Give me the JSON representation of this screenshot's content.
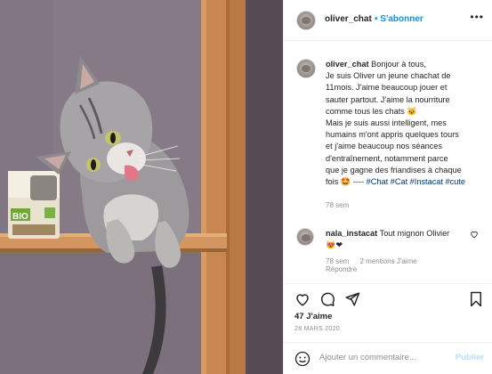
{
  "post": {
    "username": "oliver_chat",
    "follow_label": "S'abonner",
    "more_label": "•••",
    "caption_lines": [
      "Bonjour à tous,",
      "Je suis Oliver un jeune chachat de",
      "11mois. J'aime beaucoup jouer et",
      "sauter partout. J'aime la nourriture",
      "comme tous les chats 🐱",
      "Mais je suis aussi intelligent, mes",
      "humains m'ont appris quelques tours",
      "et j'aime beaucoup nos séances",
      "d'entraînement, notamment parce",
      "que je gagne des friandises à chaque",
      "fois 🤩 ---- "
    ],
    "hashtags": "#Chat #Cat #Instacat #cute",
    "caption_time": "78 sem"
  },
  "comment": {
    "username": "nala_instacat",
    "text": "Tout mignon Olivier",
    "emojis": "😻❤",
    "time": "78 sem",
    "mentions": "2 mentions J'aime",
    "reply_label": "Répondre"
  },
  "actions": {
    "likes": "47 J'aime",
    "date": "28 MARS 2020"
  },
  "add_comment": {
    "placeholder": "Ajouter un commentaire...",
    "publish_label": "Publier"
  },
  "product": {
    "bio_label": "BIO"
  },
  "colors": {
    "link": "#0095f6",
    "hashtag": "#00376b",
    "muted": "#8e8e8e",
    "publish_disabled": "#b2dffc",
    "wall": "#857986",
    "shelf_wood": "#c8844e"
  }
}
